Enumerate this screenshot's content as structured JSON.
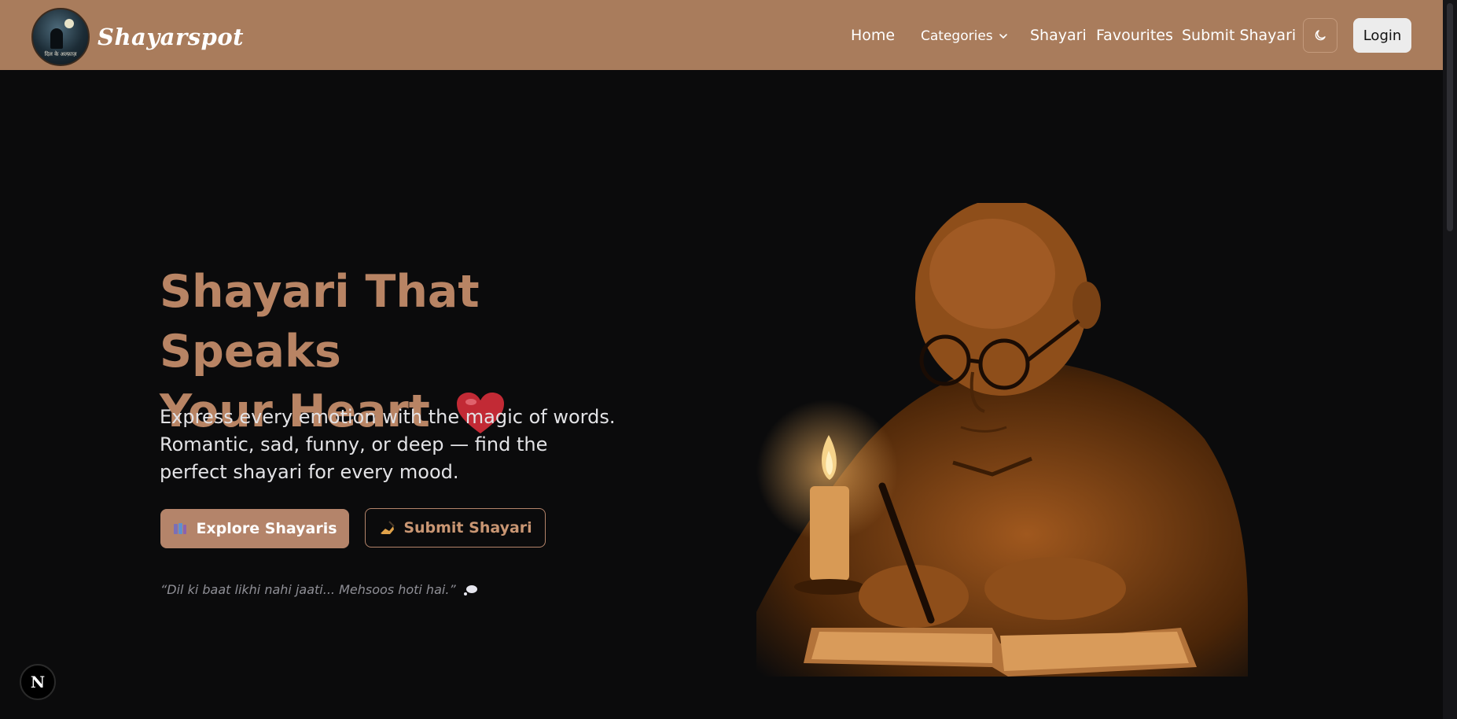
{
  "brand": {
    "name": "Shayarspot",
    "logo_caption": "दिल के अल्फ़ाज़"
  },
  "nav": {
    "links": [
      "Home",
      "Shayari",
      "Favourites",
      "Submit Shayari"
    ],
    "categories_label": "Categories",
    "login_label": "Login"
  },
  "hero": {
    "title_line1": "Shayari That Speaks",
    "title_line2": "Your Heart",
    "subtitle": "Express every emotion with the magic of words. Romantic, sad, funny, or deep — find the perfect shayari for every mood.",
    "primary_button": "Explore Shayaris",
    "secondary_button": "Submit Shayari",
    "quote": "“Dil ki baat likhi nahi jaati... Mehsoos hoti hai.”"
  },
  "icons": {
    "theme": "moon-icon",
    "primary": "books-icon",
    "secondary": "writing-hand-icon",
    "quote": "thought-bubble-icon",
    "badge": "next-js-badge"
  },
  "badge_letter": "N",
  "colors": {
    "navbar": "#a97c5c",
    "accent": "#b4846a",
    "title": "#b88464",
    "background": "#0b0b0c"
  }
}
